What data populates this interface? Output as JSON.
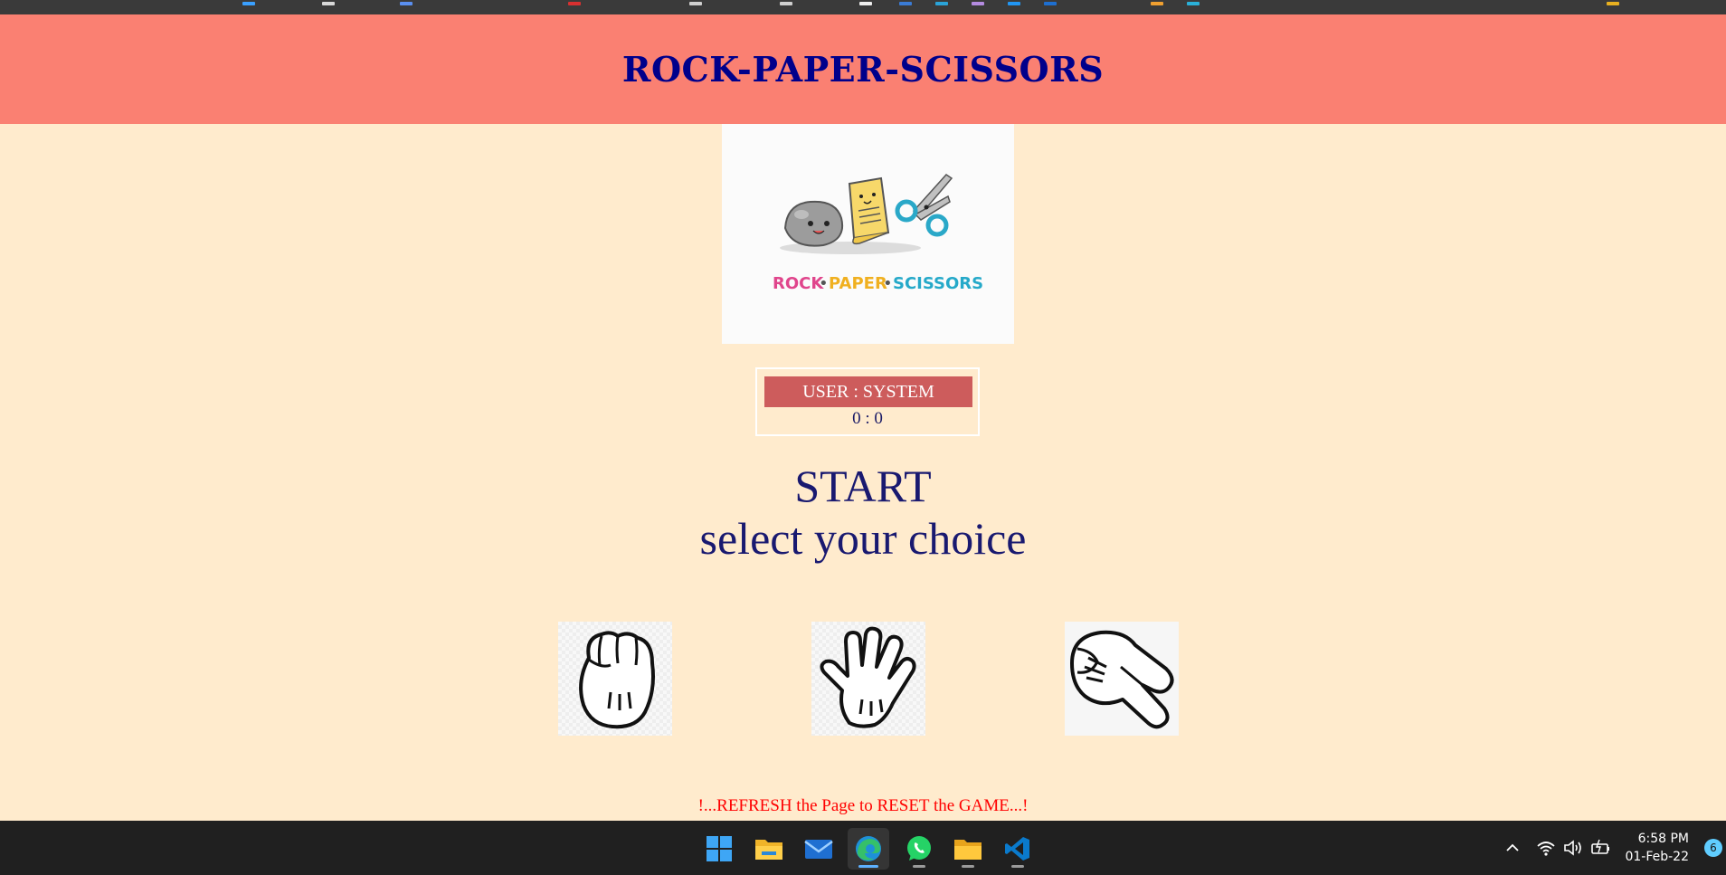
{
  "header": {
    "title": "ROCK-PAPER-SCISSORS"
  },
  "logo": {
    "words": [
      "ROCK",
      "PAPER",
      "SCISSORS"
    ],
    "separator": "•"
  },
  "scoreboard": {
    "label": "USER : SYSTEM",
    "score": "0 : 0"
  },
  "status": {
    "line1": "START",
    "line2": "select your choice"
  },
  "choices": [
    {
      "name": "rock",
      "icon": "rock-hand-icon"
    },
    {
      "name": "paper",
      "icon": "paper-hand-icon"
    },
    {
      "name": "scissors",
      "icon": "scissors-hand-icon"
    }
  ],
  "footer_note": "!...REFRESH the Page to RESET the GAME...!",
  "taskbar": {
    "apps": [
      "start-icon",
      "file-explorer-icon",
      "mail-icon",
      "edge-browser-icon",
      "whatsapp-icon",
      "folder-icon",
      "vscode-icon"
    ],
    "active_app": "edge-browser-icon",
    "clock_time": "6:58 PM",
    "clock_date": "01-Feb-22",
    "notification_count": "6"
  },
  "colors": {
    "page_bg": "#ffebcd",
    "header_bg": "#fa8072",
    "title": "#00008b",
    "score_label_bg": "#cd5c5c",
    "status_text": "#191970",
    "reset_note": "#ff0000"
  }
}
